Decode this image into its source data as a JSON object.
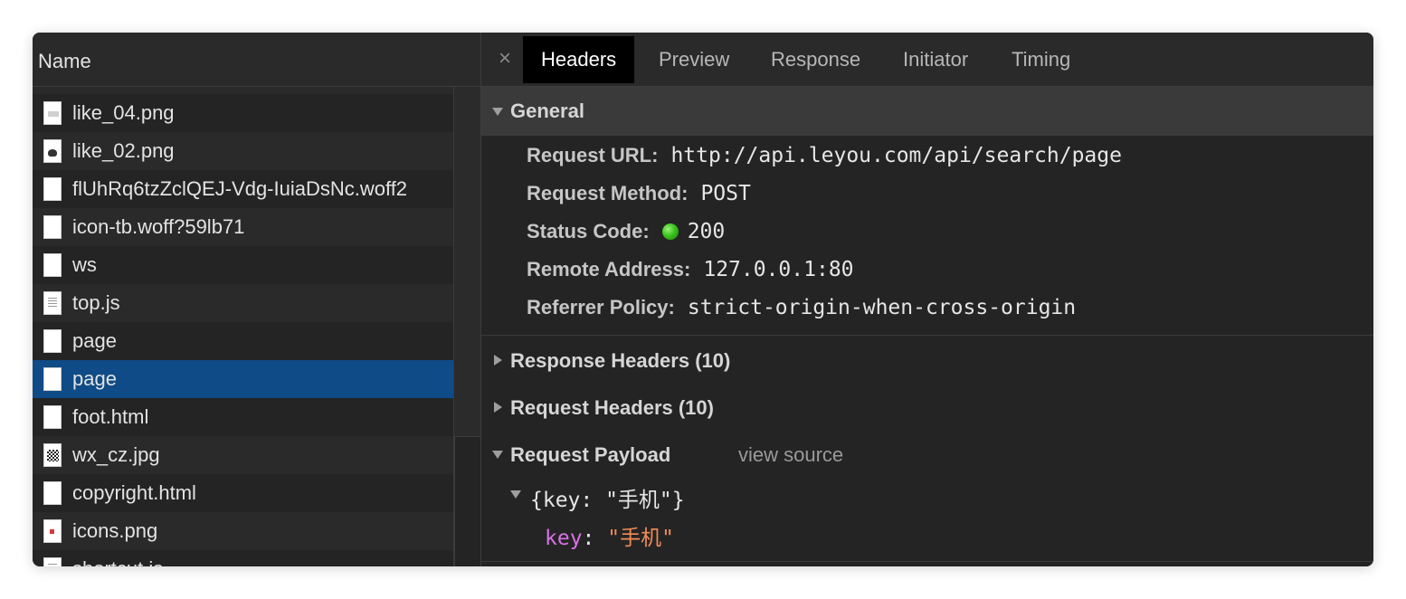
{
  "left_panel": {
    "column_header": "Name",
    "files": [
      {
        "name": "",
        "icon": "file-icon"
      },
      {
        "name": "like_04.png",
        "icon": "image-icon"
      },
      {
        "name": "like_02.png",
        "icon": "image-icon"
      },
      {
        "name": "flUhRq6tzZclQEJ-Vdg-IuiaDsNc.woff2",
        "icon": "font-file-icon"
      },
      {
        "name": "icon-tb.woff?59lb71",
        "icon": "font-file-icon"
      },
      {
        "name": "ws",
        "icon": "file-icon"
      },
      {
        "name": "top.js",
        "icon": "script-file-icon"
      },
      {
        "name": "page",
        "icon": "file-icon"
      },
      {
        "name": "page",
        "icon": "file-icon",
        "selected": true
      },
      {
        "name": "foot.html",
        "icon": "file-icon"
      },
      {
        "name": "wx_cz.jpg",
        "icon": "qr-image-icon"
      },
      {
        "name": "copyright.html",
        "icon": "file-icon"
      },
      {
        "name": "icons.png",
        "icon": "image-icon"
      },
      {
        "name": "shortcut.js",
        "icon": "script-file-icon"
      }
    ]
  },
  "tabs": {
    "close_icon": "×",
    "items": [
      "Headers",
      "Preview",
      "Response",
      "Initiator",
      "Timing"
    ],
    "active": "Headers"
  },
  "general": {
    "title": "General",
    "request_url_label": "Request URL:",
    "request_url": "http://api.leyou.com/api/search/page",
    "request_method_label": "Request Method:",
    "request_method": "POST",
    "status_code_label": "Status Code:",
    "status_code": "200",
    "status_color": "#3ac41d",
    "remote_address_label": "Remote Address:",
    "remote_address": "127.0.0.1:80",
    "referrer_policy_label": "Referrer Policy:",
    "referrer_policy": "strict-origin-when-cross-origin"
  },
  "response_headers": {
    "title": "Response Headers (10)"
  },
  "request_headers": {
    "title": "Request Headers (10)"
  },
  "request_payload": {
    "title": "Request Payload",
    "view_source": "view source",
    "object_summary": "{key: \"手机\"}",
    "key": "key",
    "value": "\"手机\""
  },
  "colors": {
    "panel_bg": "#242424",
    "selected_row": "#0f4b86",
    "active_tab": "#000000",
    "payload_key": "#d971e6",
    "payload_string": "#f38b55"
  }
}
